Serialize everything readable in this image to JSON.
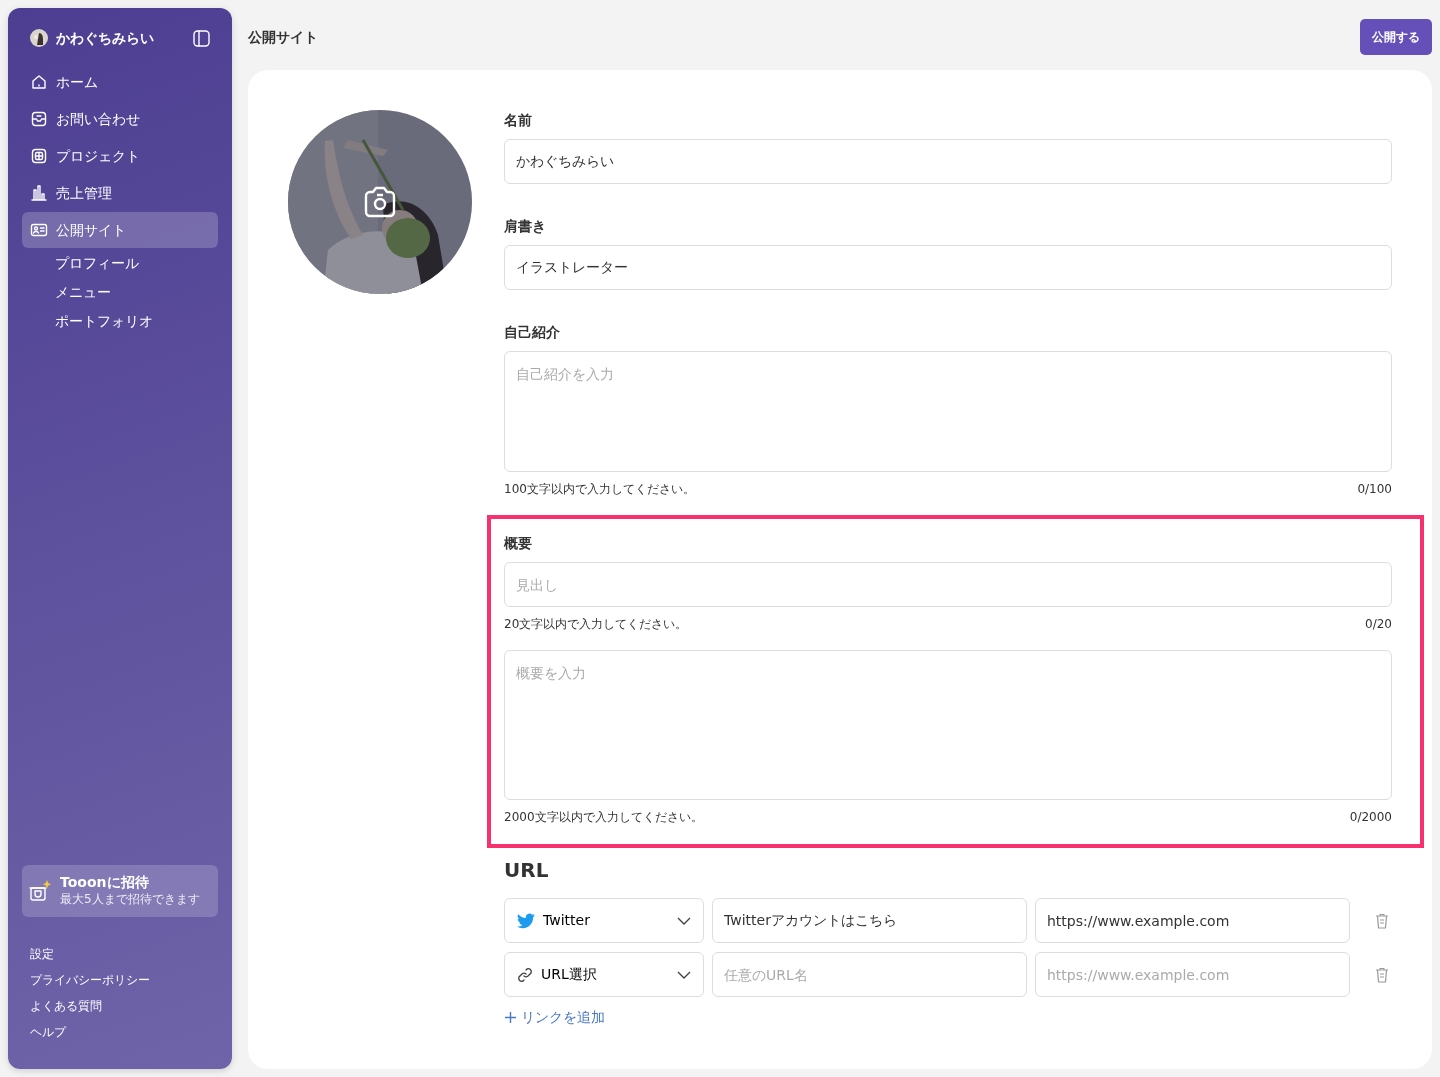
{
  "sidebar": {
    "user_name": "かわぐちみらい",
    "nav": [
      {
        "label": "ホーム",
        "selected": false
      },
      {
        "label": "お問い合わせ",
        "selected": false
      },
      {
        "label": "プロジェクト",
        "selected": false
      },
      {
        "label": "売上管理",
        "selected": false
      },
      {
        "label": "公開サイト",
        "selected": true
      }
    ],
    "subnav": [
      "プロフィール",
      "メニュー",
      "ポートフォリオ"
    ],
    "invite": {
      "title": "Tooonに招待",
      "subtitle": "最大5人まで招待できます"
    },
    "footer_links": [
      "設定",
      "プライバシーポリシー",
      "よくある質問",
      "ヘルプ"
    ]
  },
  "header": {
    "title": "公開サイト",
    "publish_button": "公開する"
  },
  "profile": {
    "fields": [
      {
        "kind": "input",
        "label": "名前",
        "value": "かわぐちみらい"
      },
      {
        "kind": "input",
        "label": "肩書き",
        "value": "イラストレーター"
      },
      {
        "kind": "textarea",
        "label": "自己紹介",
        "placeholder": "自己紹介を入力",
        "hint": "100文字以内で入力してください。",
        "counter": "0/100"
      }
    ]
  },
  "overview": {
    "highlighted": true,
    "label": "概要",
    "fields": [
      {
        "kind": "input",
        "placeholder": "見出し",
        "hint": "20文字以内で入力してください。",
        "counter": "0/20"
      },
      {
        "kind": "textarea",
        "placeholder": "概要を入力",
        "hint": "2000文字以内で入力してください。",
        "counter": "0/2000"
      }
    ]
  },
  "urls": {
    "title": "URL",
    "rows": [
      {
        "kind": "twitter",
        "select": "Twitter",
        "name": {
          "value": "Twitterアカウントはこちら"
        },
        "url": {
          "value": "https://www.example.com"
        }
      },
      {
        "kind": "link",
        "select": "URL選択",
        "name": {
          "placeholder": "任意のURL名"
        },
        "url": {
          "placeholder": "https://www.example.com"
        }
      }
    ],
    "add_link": "リンクを追加"
  }
}
